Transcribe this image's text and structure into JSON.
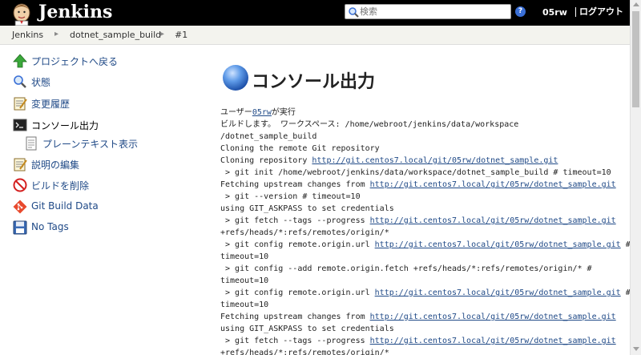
{
  "header": {
    "brand": "Jenkins",
    "search_placeholder": "検索",
    "help_label": "?",
    "user": "05rw",
    "logout": "ログアウト"
  },
  "breadcrumb": {
    "items": [
      "Jenkins",
      "dotnet_sample_build",
      "#1"
    ],
    "separator": "▸"
  },
  "sidebar": {
    "items": [
      {
        "label": "プロジェクトへ戻る",
        "icon": "up-arrow-icon"
      },
      {
        "label": "状態",
        "icon": "magnifier-icon"
      },
      {
        "label": "変更履歴",
        "icon": "notepad-icon"
      },
      {
        "label": "コンソール出力",
        "icon": "terminal-icon"
      },
      {
        "label": "プレーンテキスト表示",
        "icon": "document-icon"
      },
      {
        "label": "説明の編集",
        "icon": "notepad-icon"
      },
      {
        "label": "ビルドを削除",
        "icon": "no-entry-icon"
      },
      {
        "label": "Git Build Data",
        "icon": "git-icon"
      },
      {
        "label": "No Tags",
        "icon": "floppy-icon"
      }
    ]
  },
  "main": {
    "title": "コンソール出力",
    "console": {
      "started_prefix": "ユーザー",
      "started_user": "05rw",
      "started_suffix": "が実行",
      "line_building": "ビルドします。 ワークスペース: /home/webroot/jenkins/data/workspace",
      "line_ws_cont": "/dotnet_sample_build",
      "line_cloning": "Cloning the remote Git repository",
      "line_cloning_repo": "Cloning repository ",
      "repo_url": "http://git.centos7.local/git/05rw/dotnet_sample.git",
      "line_git_init": " > git init /home/webroot/jenkins/data/workspace/dotnet_sample_build # timeout=10",
      "line_fetch_upstream": "Fetching upstream changes from ",
      "line_git_version": " > git --version # timeout=10",
      "line_askpass": "using GIT_ASKPASS to set credentials",
      "line_git_fetch": " > git fetch --tags --progress ",
      "line_refs": "+refs/heads/*:refs/remotes/origin/*",
      "line_config_url": " > git config remote.origin.url ",
      "hash_suffix": " #",
      "line_timeout": "timeout=10",
      "line_config_add": " > git config --add remote.origin.fetch +refs/heads/*:refs/remotes/origin/* #"
    }
  },
  "colors": {
    "header_bg": "#000000",
    "breadcrumb_bg": "#f3f3ee",
    "link": "#204a87"
  }
}
